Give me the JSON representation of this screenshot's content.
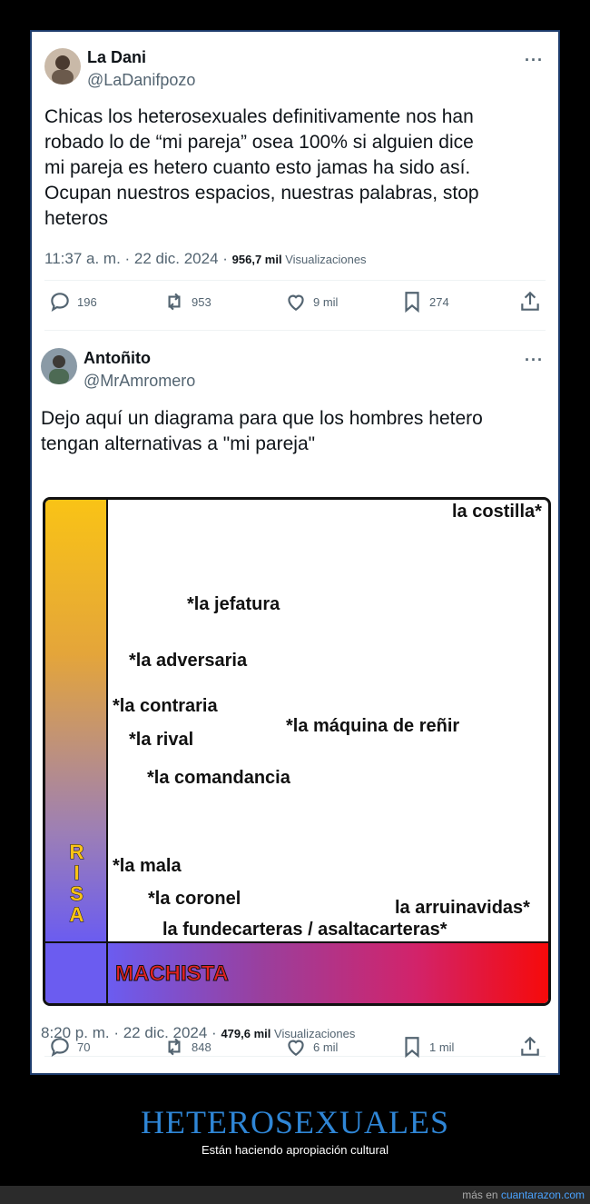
{
  "tweet1": {
    "name": "La Dani",
    "handle": "@LaDanifpozo",
    "text_lines": [
      "Chicas los heterosexuales definitivamente nos han",
      "robado lo de “mi pareja” osea 100% si alguien dice",
      "mi pareja es hetero cuanto esto jamas ha sido así.",
      "Ocupan nuestros espacios, nuestras palabras, stop",
      "heteros"
    ],
    "time": "11:37 a. m. · 22 dic. 2024 · ",
    "views": "956,7 mil",
    "views_label": " Visualizaciones",
    "replies": "196",
    "retweets": "953",
    "likes": "9 mil",
    "bookmarks": "274"
  },
  "tweet2": {
    "name": "Antoñito",
    "handle": "@MrAmromero",
    "text_lines": [
      "Dejo aquí un diagrama para que los hombres hetero",
      "tengan alternativas a \"mi pareja\""
    ],
    "time": "8:20 p. m. · 22 dic. 2024 · ",
    "views": "479,6 mil",
    "views_label": " Visualizaciones",
    "replies": "70",
    "retweets": "848",
    "likes": "6 mil",
    "bookmarks": "1 mil"
  },
  "diagram": {
    "y_axis_label": "RISA",
    "x_axis_label": "MACHISTA",
    "labels": [
      "la costilla*",
      "*la jefatura",
      "*la adversaria",
      "*la contraria",
      "*la rival",
      "*la máquina de reñir",
      "*la comandancia",
      "*la mala",
      "*la coronel",
      "la arruinavidas*",
      "la fundecarteras / asaltacarteras*"
    ]
  },
  "caption": {
    "title": "HETEROSEXUALES",
    "subtitle": "Están haciendo apropiación cultural"
  },
  "footer": {
    "prefix": "más en ",
    "site": "cuantarazon.com"
  },
  "colors": {
    "accent": "#2f86d6",
    "axis_yellow": "#f9c316",
    "axis_purple": "#6b5cf0",
    "axis_red": "#f60a0a"
  }
}
